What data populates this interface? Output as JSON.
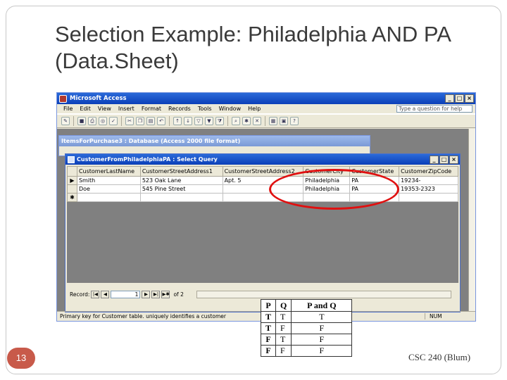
{
  "slide": {
    "title": "Selection Example: Philadelphia AND PA (Data.Sheet)",
    "number": "13",
    "footer": "CSC 240 (Blum)"
  },
  "access": {
    "app_title": "Microsoft Access",
    "menus": [
      "File",
      "Edit",
      "View",
      "Insert",
      "Format",
      "Records",
      "Tools",
      "Window",
      "Help"
    ],
    "ask_placeholder": "Type a question for help",
    "toolbar_icons": [
      "design-icon",
      "save-icon",
      "print-icon",
      "preview-icon",
      "spelling-icon",
      "cut-icon",
      "copy-icon",
      "paste-icon",
      "undo-icon",
      "sort-asc-icon",
      "sort-desc-icon",
      "filter-selection-icon",
      "filter-form-icon",
      "apply-filter-icon",
      "find-icon",
      "new-record-icon",
      "delete-record-icon",
      "database-window-icon",
      "new-object-icon",
      "help-icon"
    ],
    "db_window_title": "ItemsForPurchase3 : Database (Access 2000 file format)",
    "query_title": "CustomerFromPhiladelphiaPA : Select Query",
    "columns": [
      "CustomerLastName",
      "CustomerStreetAddress1",
      "CustomerStreetAddress2",
      "CustomerCity",
      "CustomerState",
      "CustomerZipCode"
    ],
    "rows": [
      [
        "Smith",
        "523 Oak Lane",
        "Apt. 5",
        "Philadelphia",
        "PA",
        "19234-"
      ],
      [
        "Doe",
        "545 Pine Street",
        "",
        "Philadelphia",
        "PA",
        "19353-2323"
      ]
    ],
    "nav": {
      "label": "Record:",
      "current": "1",
      "of_text": "of 2"
    },
    "status_text": "Primary key for Customer table. uniquely identifies a customer",
    "num_indicator": "NUM"
  },
  "truth_table": {
    "headers": [
      "P",
      "Q",
      "P and Q"
    ],
    "rows": [
      [
        "T",
        "T",
        "T"
      ],
      [
        "T",
        "F",
        "F"
      ],
      [
        "F",
        "T",
        "F"
      ],
      [
        "F",
        "F",
        "F"
      ]
    ]
  },
  "colors": {
    "highlight_oval": "#e01010",
    "slide_number_bg": "#c85a4a",
    "titlebar": "#0b3fb8"
  }
}
